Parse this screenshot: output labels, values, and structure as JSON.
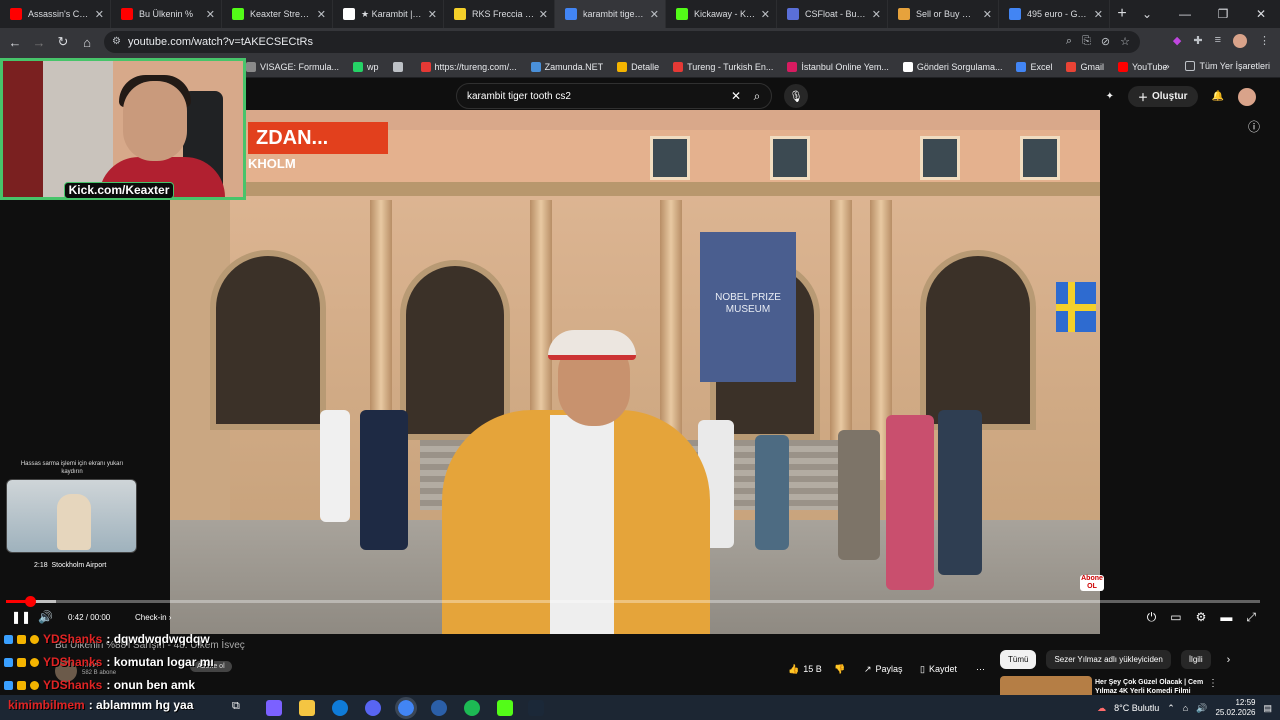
{
  "browser": {
    "tabs": [
      {
        "title": "Assassin's Creed",
        "color": "#ff0000"
      },
      {
        "title": "Bu Ülkenin %",
        "color": "#ff0000"
      },
      {
        "title": "Keaxter Stream -",
        "color": "#53fc18"
      },
      {
        "title": "★ Karambit | Urb",
        "color": "#ffffff"
      },
      {
        "title": "RKS Freccia 150",
        "color": "#f4d02a"
      },
      {
        "title": "karambit tiger to",
        "color": "#4285f4"
      },
      {
        "title": "Kickaway - Kick C",
        "color": "#53fc18"
      },
      {
        "title": "CSFloat - Buy & S",
        "color": "#5a6fd8"
      },
      {
        "title": "Sell or Buy ★ Hu",
        "color": "#e6a23c"
      },
      {
        "title": "495 euro - Googl",
        "color": "#4285f4"
      }
    ],
    "url": "youtube.com/watch?v=tAKECSECtRs",
    "bookmarks": [
      {
        "label": "VISAGE: Formula...",
        "color": "#8a8a8a"
      },
      {
        "label": "wp",
        "color": "#25d366"
      },
      {
        "label": "",
        "color": "#bdc1c6"
      },
      {
        "label": "https://tureng.com/...",
        "color": "#e53935"
      },
      {
        "label": "Zamunda.NET",
        "color": "#4a90d9"
      },
      {
        "label": "Detalle",
        "color": "#f4b400"
      },
      {
        "label": "Tureng - Turkish En...",
        "color": "#e53935"
      },
      {
        "label": "İstanbul Online Yem...",
        "color": "#d81b60"
      },
      {
        "label": "Gönderi Sorgulama...",
        "color": "#ffffff"
      },
      {
        "label": "Excel",
        "color": "#4285f4"
      },
      {
        "label": "Gmail",
        "color": "#ea4335"
      },
      {
        "label": "YouTube",
        "color": "#ff0000"
      }
    ],
    "bookmarks_more": "»",
    "all_bookmarks": "Tüm Yer İşaretleri"
  },
  "youtube": {
    "search_query": "karambit tiger tooth cs2",
    "create_label": "Oluştur",
    "player": {
      "overlay_title": "ZDAN...",
      "overlay_subtitle": "KHOLM",
      "banner_text": "NOBEL PRIZE MUSEUM",
      "time": "0:42 / 00:00",
      "chapter": "Check-in",
      "progress_fraction": 0.019,
      "subscribe_badge": "Abone OL"
    },
    "end_screen": {
      "note": "Hassas sarma işlemi için ekranı yukarı kaydırın",
      "duration": "2:18",
      "title": "Stockholm Airport"
    },
    "below": {
      "video_title": "Bu Ülkenin %88'i Sarışın - 48. Ülkem İsveç",
      "channel": "Kaan",
      "subs": "582 B abone",
      "subscribe": "Abone ol",
      "likes": "15 B",
      "share": "Paylaş",
      "save": "Kaydet",
      "more": "⋯"
    },
    "chips": [
      "Tümü",
      "Sezer Yılmaz adlı yükleyiciden",
      "İlgili"
    ],
    "rec_title": "Her Şey Çok Güzel Olacak | Cem Yılmaz 4K Yerli Komedi Filmi"
  },
  "stream": {
    "webcam_label": "Kick.com/Keaxter",
    "chat": [
      {
        "user": "YDShanks",
        "message": ": dqwdwqdwqdqw"
      },
      {
        "user": "YDShanks",
        "message": ": komutan logar mı"
      },
      {
        "user": "YDShanks",
        "message": ": onun ben amk"
      },
      {
        "user": "kimimbilmem",
        "message": ": ablammm hg yaa"
      }
    ]
  },
  "taskbar": {
    "weather": "8°C  Bulutlu",
    "time": "12:59",
    "date": "25.02.2026"
  }
}
